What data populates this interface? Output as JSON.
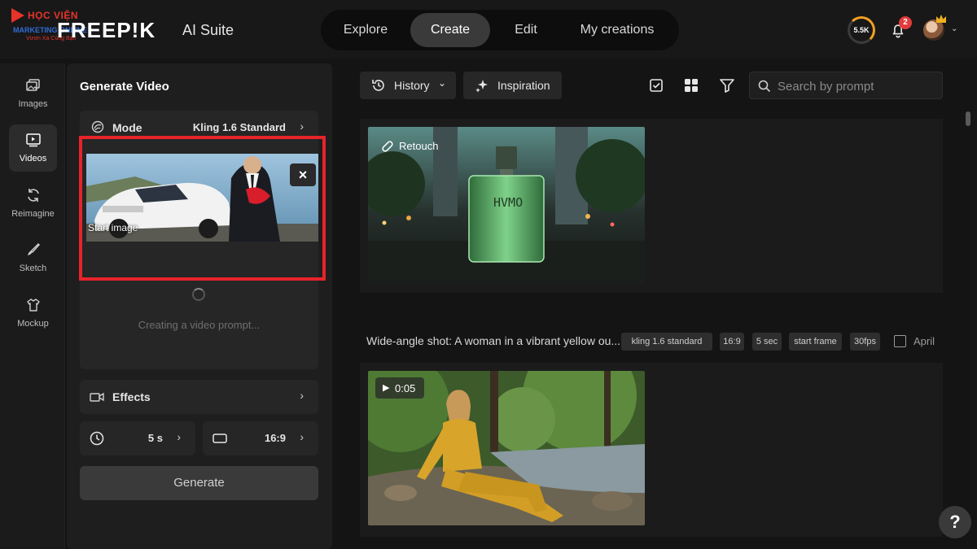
{
  "watermark": {
    "title": "HỌC VIỆN",
    "subtitle": "MARKETING ONLINE",
    "tagline": "Vươn Xa Cùng Bạn"
  },
  "header": {
    "brand": "FREEP!K",
    "suite": "AI Suite",
    "nav": [
      {
        "label": "Explore"
      },
      {
        "label": "Create",
        "active": true
      },
      {
        "label": "Edit"
      },
      {
        "label": "My creations"
      }
    ],
    "credits": "5.5K",
    "notifications": "2"
  },
  "rail": [
    {
      "label": "Images",
      "icon": "images-icon"
    },
    {
      "label": "Videos",
      "icon": "videos-icon",
      "active": true
    },
    {
      "label": "Reimagine",
      "icon": "reimagine-icon"
    },
    {
      "label": "Sketch",
      "icon": "sketch-icon"
    },
    {
      "label": "Mockup",
      "icon": "mockup-icon"
    }
  ],
  "panel": {
    "title": "Generate Video",
    "mode_label": "Mode",
    "mode_value": "Kling 1.6 Standard",
    "start_image_label": "Start image",
    "prompt_status": "Creating a video prompt...",
    "effects_label": "Effects",
    "duration": "5 s",
    "aspect": "16:9",
    "generate_label": "Generate"
  },
  "toolbar": {
    "history_label": "History",
    "inspiration_label": "Inspiration",
    "search_placeholder": "Search by prompt"
  },
  "results": {
    "item1": {
      "badge": "Retouch",
      "bottle_text": "HVMO"
    },
    "item2": {
      "caption": "Wide-angle shot: A woman in a vibrant yellow ou...",
      "tags": [
        "kling 1.6 standard",
        "16:9",
        "5 sec",
        "start frame",
        "30fps"
      ],
      "date": "April",
      "duration": "0:05"
    }
  },
  "colors": {
    "highlight": "#e8232a",
    "accent": "#f0a020",
    "badge": "#e23b3b"
  }
}
